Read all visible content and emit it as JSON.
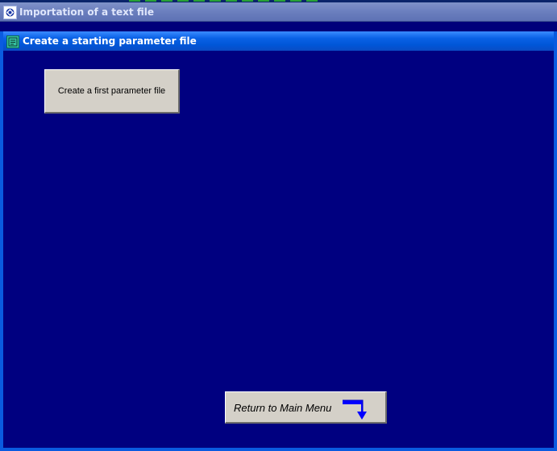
{
  "outer_window": {
    "title": "Importation of a text file"
  },
  "inner_window": {
    "title": "Create a starting parameter file"
  },
  "buttons": {
    "create_first": "Create a first parameter file",
    "return_main": "Return to Main Menu"
  },
  "colors": {
    "desktop": "#000080",
    "outer_titlebar": "#6b7fbe",
    "inner_titlebar": "#0a62e6",
    "button_face": "#d4d0c8",
    "arrow": "#0000ff"
  },
  "icons": {
    "outer_title": "app-icon",
    "inner_title": "form-icon",
    "return_arrow": "return-arrow-icon"
  }
}
